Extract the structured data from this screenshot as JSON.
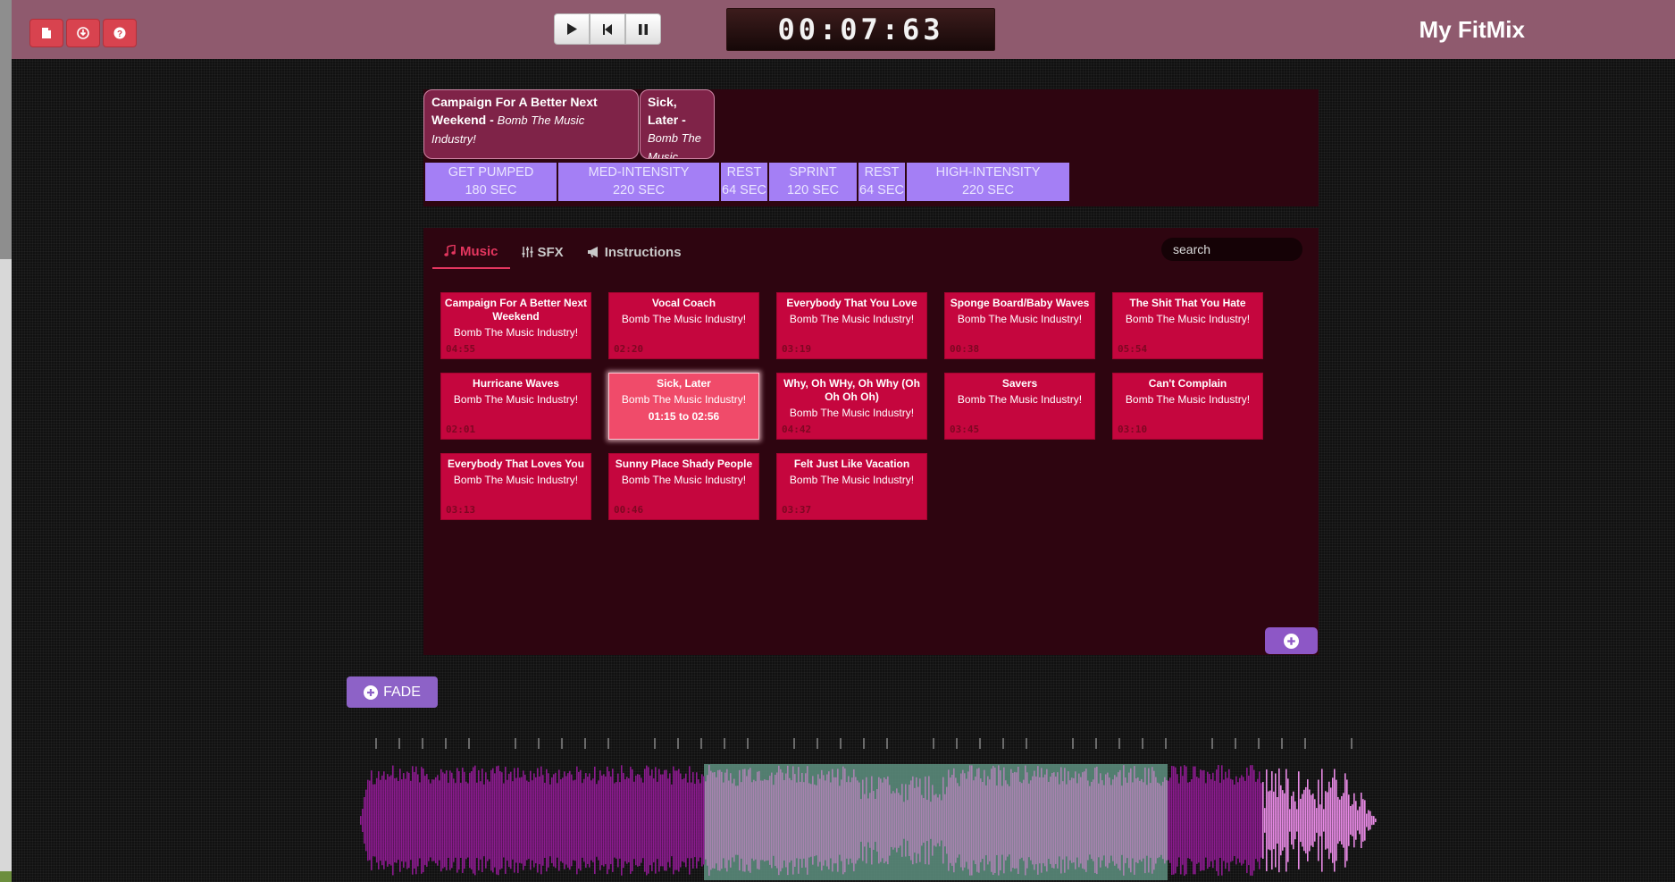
{
  "app": {
    "title": "My FitMix"
  },
  "toolbar": {
    "file_buttons": [
      {
        "name": "new-file-button",
        "icon": "file-icon"
      },
      {
        "name": "download-button",
        "icon": "download-icon"
      },
      {
        "name": "help-button",
        "icon": "question-icon"
      }
    ],
    "transport": [
      {
        "name": "play-button",
        "icon": "play-icon"
      },
      {
        "name": "rewind-button",
        "icon": "skip-back-icon"
      },
      {
        "name": "pause-button",
        "icon": "pause-icon"
      }
    ]
  },
  "timer": {
    "display": "00:07:63"
  },
  "mix": {
    "songs": [
      {
        "title": "Campaign For A Better Next Weekend -",
        "artist": "Bomb The Music Industry!"
      },
      {
        "title": "Sick, Later -",
        "artist": "Bomb The Music"
      }
    ],
    "segments": [
      {
        "name": "GET PUMPED",
        "duration": "180 SEC"
      },
      {
        "name": "MED-INTENSITY",
        "duration": "220 SEC"
      },
      {
        "name": "REST",
        "duration": "64 SEC"
      },
      {
        "name": "SPRINT",
        "duration": "120 SEC"
      },
      {
        "name": "REST",
        "duration": "64 SEC"
      },
      {
        "name": "HIGH-INTENSITY",
        "duration": "220 SEC"
      }
    ]
  },
  "library": {
    "tabs": [
      {
        "label": "Music",
        "icon": "music-note-icon",
        "active": true
      },
      {
        "label": "SFX",
        "icon": "sliders-icon",
        "active": false
      },
      {
        "label": "Instructions",
        "icon": "megaphone-icon",
        "active": false
      }
    ],
    "search": {
      "placeholder": "search",
      "value": ""
    },
    "tracks": [
      {
        "title": "Campaign For A Better Next Weekend",
        "artist": "Bomb The Music Industry!",
        "duration": "04:55"
      },
      {
        "title": "Vocal Coach",
        "artist": "Bomb The Music Industry!",
        "duration": "02:20"
      },
      {
        "title": "Everybody That You Love",
        "artist": "Bomb The Music Industry!",
        "duration": "03:19"
      },
      {
        "title": "Sponge Board/Baby Waves",
        "artist": "Bomb The Music Industry!",
        "duration": "00:38"
      },
      {
        "title": "The Shit That You Hate",
        "artist": "Bomb The Music Industry!",
        "duration": "05:54"
      },
      {
        "title": "Hurricane Waves",
        "artist": "Bomb The Music Industry!",
        "duration": "02:01"
      },
      {
        "title": "Sick, Later",
        "artist": "Bomb The Music Industry!",
        "range": "01:15 to 02:56",
        "selected": true
      },
      {
        "title": "Why, Oh WHy, Oh Why (Oh Oh Oh Oh)",
        "artist": "Bomb The Music Industry!",
        "duration": "04:42"
      },
      {
        "title": "Savers",
        "artist": "Bomb The Music Industry!",
        "duration": "03:45"
      },
      {
        "title": "Can't Complain",
        "artist": "Bomb The Music Industry!",
        "duration": "03:10"
      },
      {
        "title": "Everybody That Loves You",
        "artist": "Bomb The Music Industry!",
        "duration": "03:13"
      },
      {
        "title": "Sunny Place Shady People",
        "artist": "Bomb The Music Industry!",
        "duration": "00:46"
      },
      {
        "title": "Felt Just Like Vacation",
        "artist": "Bomb The Music Industry!",
        "duration": "03:37"
      }
    ]
  },
  "fade": {
    "label": "FADE",
    "icon": "plus-circle-icon"
  },
  "add": {
    "icon": "plus-circle-icon"
  },
  "colors": {
    "topbar": "#8f5a6e",
    "card": "#c5063e",
    "card_selected": "#f04b6a",
    "segment": "#a47ff5",
    "wave_purple": "#8c1a8f",
    "wave_selected": "#a883b0",
    "wave_pink": "#e98ae6"
  }
}
